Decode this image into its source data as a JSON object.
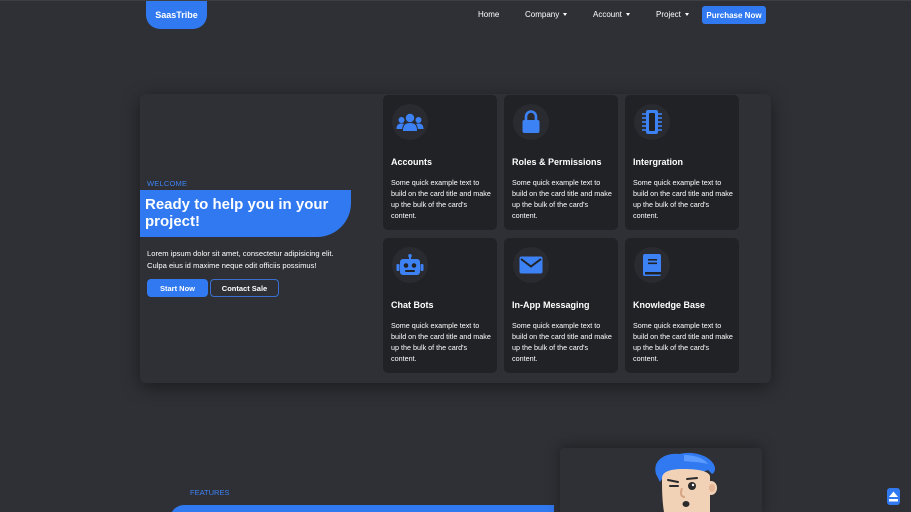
{
  "navbar": {
    "brand": "SaasTribe",
    "links": [
      {
        "label": "Home",
        "has_dropdown": false
      },
      {
        "label": "Company",
        "has_dropdown": true
      },
      {
        "label": "Account",
        "has_dropdown": true
      },
      {
        "label": "Project",
        "has_dropdown": true
      }
    ],
    "purchase_label": "Purchase Now"
  },
  "hero": {
    "welcome": "WELCOME",
    "title": "Ready to help you in your project!",
    "description": "Lorem ipsum dolor sit amet, consectetur adipisicing elit. Culpa eius id maxime neque odit officiis possimus!",
    "start_label": "Start Now",
    "contact_label": "Contact Sale"
  },
  "cards": [
    {
      "icon": "users-icon",
      "title": "Accounts",
      "text": "Some quick example text to build on the card title and make up the bulk of the card's content."
    },
    {
      "icon": "lock-icon",
      "title": "Roles & Permissions",
      "text": "Some quick example text to build on the card title and make up the bulk of the card's content."
    },
    {
      "icon": "microchip-icon",
      "title": "Intergration",
      "text": "Some quick example text to build on the card title and make up the bulk of the card's content."
    },
    {
      "icon": "robot-icon",
      "title": "Chat Bots",
      "text": "Some quick example text to build on the card title and make up the bulk of the card's content."
    },
    {
      "icon": "envelope-icon",
      "title": "In-App Messaging",
      "text": "Some quick example text to build on the card title and make up the bulk of the card's content."
    },
    {
      "icon": "book-icon",
      "title": "Knowledge Base",
      "text": "Some quick example text to build on the card title and make up the bulk of the card's content."
    }
  ],
  "features": {
    "label": "FEATURES"
  },
  "colors": {
    "accent": "#3079f0",
    "background": "#2f3035",
    "card": "#212226"
  }
}
